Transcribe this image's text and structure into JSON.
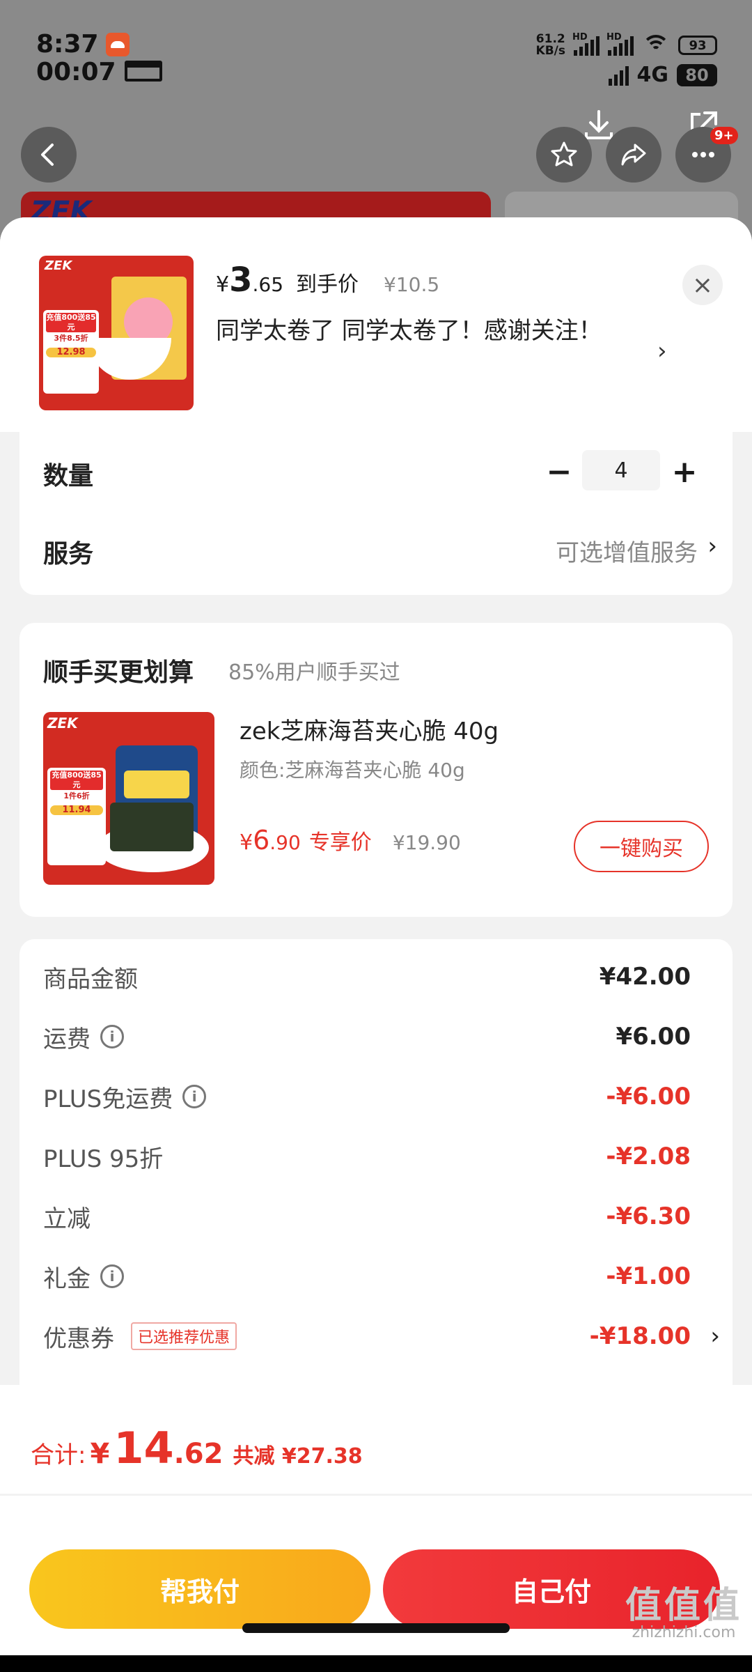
{
  "status": {
    "time1": "8:37",
    "time2": "00:07",
    "net_speed_value": "61.2",
    "net_speed_unit": "KB/s",
    "hd1": "HD",
    "hd2": "HD",
    "battery1": "93",
    "network": "4G",
    "battery2": "80"
  },
  "background": {
    "brand_logo": "ZEK",
    "notif_badge": "9+"
  },
  "product": {
    "currency": "¥",
    "price_int": "3",
    "price_dec": ".65",
    "price_label": "到手价",
    "original_price": "¥10.5",
    "title": "同学太卷了 同学太卷了！感谢关注！",
    "thumb_brand": "ZEK",
    "thumb_tag_a": "充值800送85元",
    "thumb_tag_b": "3件8.5折",
    "thumb_tag_price": "12.98"
  },
  "options": {
    "quantity_label": "数量",
    "quantity_value": "4",
    "minus": "−",
    "plus": "+",
    "service_label": "服务",
    "service_value": "可选增值服务",
    "chevron": "›"
  },
  "addon": {
    "title": "顺手买更划算",
    "subtitle": "85%用户顺手买过",
    "image_brand": "ZEK",
    "image_tag_a": "充值800送85元",
    "image_tag_b": "1件6折",
    "image_tag_price": "11.94",
    "name": "zek芝麻海苔夹心脆 40g",
    "spec": "颜色:芝麻海苔夹心脆 40g",
    "currency": "¥",
    "price_int": "6",
    "price_dec": ".90",
    "price_label": "专享价",
    "original_price": "¥19.90",
    "buy_button": "一键购买"
  },
  "fees": [
    {
      "label": "商品金额",
      "value": "¥42.00",
      "info": false,
      "red": false
    },
    {
      "label": "运费",
      "value": "¥6.00",
      "info": true,
      "red": false
    },
    {
      "label": "PLUS免运费",
      "value": "-¥6.00",
      "info": true,
      "red": true
    },
    {
      "label": "PLUS 95折",
      "value": "-¥2.08",
      "info": false,
      "red": true
    },
    {
      "label": "立减",
      "value": "-¥6.30",
      "info": false,
      "red": true
    },
    {
      "label": "礼金",
      "value": "-¥1.00",
      "info": true,
      "red": true
    }
  ],
  "coupon": {
    "label": "优惠券",
    "tag": "已选推荐优惠",
    "value": "-¥18.00"
  },
  "footer": {
    "total_label": "合计:",
    "currency": "¥",
    "total_int": "14",
    "total_dec": ".62",
    "saved": "共减 ¥27.38",
    "help_pay": "帮我付",
    "self_pay": "自己付"
  },
  "watermark": {
    "logo": "值值值",
    "site": "zhizhizhi.com"
  },
  "colors": {
    "accent_red": "#e63329",
    "help_pay_yellow": "#f9c61d",
    "self_pay_red": "#e8232b"
  }
}
